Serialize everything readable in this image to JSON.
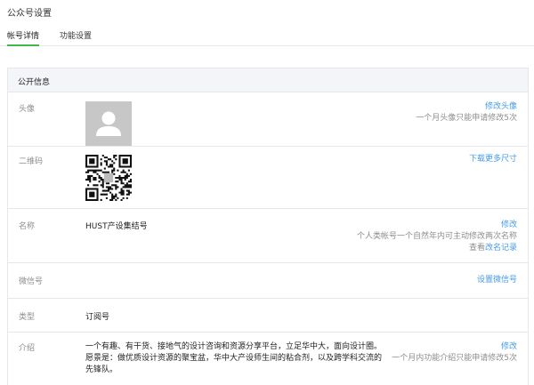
{
  "page": {
    "title": "公众号设置"
  },
  "tabs": [
    {
      "label": "帐号详情",
      "active": true
    },
    {
      "label": "功能设置",
      "active": false
    }
  ],
  "panel": {
    "header": "公开信息"
  },
  "rows": {
    "avatar": {
      "label": "头像",
      "action": "修改头像",
      "note": "一个月头像只能申请修改5次"
    },
    "qrcode": {
      "label": "二维码",
      "action": "下载更多尺寸"
    },
    "name": {
      "label": "名称",
      "value": "HUST产设集结号",
      "action": "修改",
      "note": "个人类帐号一个自然年内可主动修改两次名称",
      "history_prefix": "查看",
      "history_link": "改名记录"
    },
    "wechat_id": {
      "label": "微信号",
      "action": "设置微信号"
    },
    "type": {
      "label": "类型",
      "value": "订阅号"
    },
    "intro": {
      "label": "介绍",
      "line1": "一个有趣、有干货、接地气的设计咨询和资源分享平台，立足华中大，面向设计圈。",
      "line2": "愿景是：做优质设计资源的聚宝盆，华中大产设师生间的粘合剂，以及跨学科交流的",
      "line3": "先锋队。",
      "action": "修改",
      "note": "一个月内功能介绍只能申请修改5次"
    }
  },
  "colors": {
    "accent_green": "#44b549",
    "link_blue": "#459ae9",
    "muted": "#8d8d8d",
    "border": "#e7e7eb",
    "header_bg": "#f4f5f9"
  }
}
